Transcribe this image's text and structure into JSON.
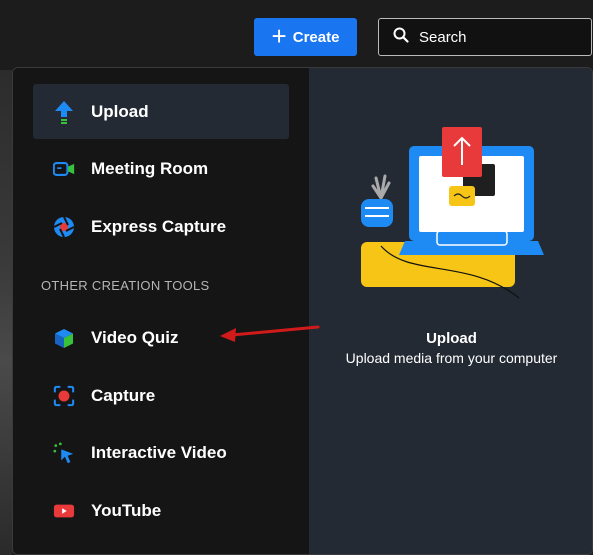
{
  "header": {
    "create_label": "Create",
    "search_label": "Search"
  },
  "menu": {
    "items": [
      {
        "label": "Upload",
        "icon": "upload-icon"
      },
      {
        "label": "Meeting Room",
        "icon": "meeting-room-icon"
      },
      {
        "label": "Express Capture",
        "icon": "express-capture-icon"
      }
    ],
    "section_label": "OTHER CREATION TOOLS",
    "other_items": [
      {
        "label": "Video Quiz",
        "icon": "video-quiz-icon"
      },
      {
        "label": "Capture",
        "icon": "capture-icon"
      },
      {
        "label": "Interactive Video",
        "icon": "interactive-video-icon"
      },
      {
        "label": "YouTube",
        "icon": "youtube-icon"
      }
    ]
  },
  "preview": {
    "title": "Upload",
    "description": "Upload media from your computer"
  },
  "colors": {
    "accent": "#1976f0",
    "highlight": "#e8eb0d",
    "annotation_arrow": "#d11a1a"
  }
}
